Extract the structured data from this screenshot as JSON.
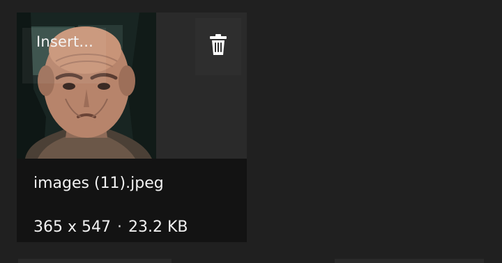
{
  "card": {
    "insert_label": "Insert...",
    "delete_icon": "trash-icon",
    "filename": "images (11).jpeg",
    "dimensions": "365 x 547",
    "separator": "·",
    "filesize": "23.2 KB"
  },
  "colors": {
    "background": "#202020",
    "card": "#2a2a2a",
    "info_panel": "#131313",
    "text": "#f2f2f2"
  }
}
